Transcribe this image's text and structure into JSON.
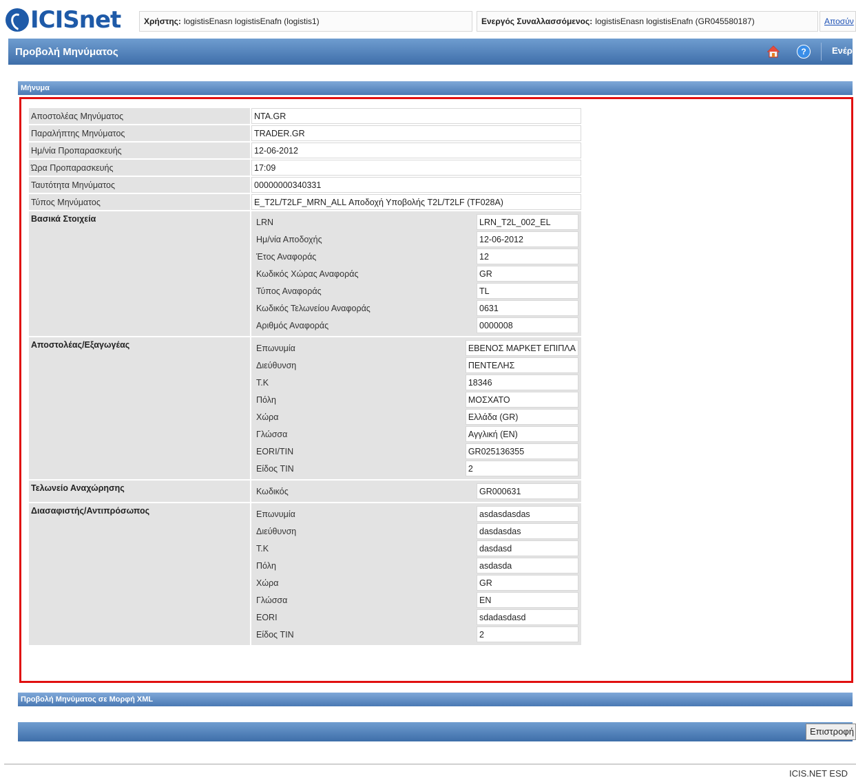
{
  "app": {
    "logo_text": "ICISnet"
  },
  "header": {
    "user_label": "Χρήστης:",
    "user_value": "logistisEnasn logistisEnafn (logistis1)",
    "active_label": "Ενεργός Συναλλασσόμενος:",
    "active_value": "logistisEnasn logistisEnafn (GR045580187)",
    "logout": "Αποσύν"
  },
  "titlebar": {
    "title": "Προβολή Μηνύματος",
    "link": "Ενέργε"
  },
  "section": {
    "title": "Μήνυμα"
  },
  "message": {
    "fields": [
      {
        "label": "Αποστολέας Μηνύματος",
        "value": "NTA.GR"
      },
      {
        "label": "Παραλήπτης Μηνύματος",
        "value": "TRADER.GR"
      },
      {
        "label": "Ημ/νία Προπαρασκευής",
        "value": "12-06-2012"
      },
      {
        "label": "Ώρα Προπαρασκευής",
        "value": "17:09"
      },
      {
        "label": "Ταυτότητα Μηνύματος",
        "value": "00000000340331"
      },
      {
        "label": "Τύπος Μηνύματος",
        "value": "E_T2L/T2LF_MRN_ALL Αποδοχή Υποβολής T2L/T2LF (TF028A)"
      }
    ],
    "groups": [
      {
        "title": "Βασικά Στοιχεία",
        "rows": [
          {
            "label": "LRN",
            "value": "LRN_T2L_002_EL"
          },
          {
            "label": "Ημ/νία Αποδοχής",
            "value": "12-06-2012"
          },
          {
            "label": "Έτος Αναφοράς",
            "value": "12"
          },
          {
            "label": "Κωδικός Χώρας Αναφοράς",
            "value": "GR"
          },
          {
            "label": "Τύπος Αναφοράς",
            "value": "TL"
          },
          {
            "label": "Κωδικός Τελωνείου Αναφοράς",
            "value": "0631"
          },
          {
            "label": "Αριθμός Αναφοράς",
            "value": "0000008"
          }
        ]
      },
      {
        "title": "Αποστολέας/Εξαγωγέας",
        "rows": [
          {
            "label": "Επωνυμία",
            "value": "ΕΒΕΝΟΣ ΜΑΡΚΕΤ ΕΠΙΠΛΑ"
          },
          {
            "label": "Διεύθυνση",
            "value": "ΠΕΝΤΕΛΗΣ"
          },
          {
            "label": "Τ.Κ",
            "value": "18346"
          },
          {
            "label": "Πόλη",
            "value": "ΜΟΣΧΑΤΟ"
          },
          {
            "label": "Χώρα",
            "value": "Ελλάδα (GR)"
          },
          {
            "label": "Γλώσσα",
            "value": "Αγγλική (EN)"
          },
          {
            "label": "EORI/TIN",
            "value": "GR025136355"
          },
          {
            "label": "Είδος TIN",
            "value": "2"
          }
        ]
      },
      {
        "title": "Τελωνείο Αναχώρησης",
        "rows": [
          {
            "label": "Κωδικός",
            "value": "GR000631"
          }
        ]
      },
      {
        "title": "Διασαφιστής/Αντιπρόσωπος",
        "rows": [
          {
            "label": "Επωνυμία",
            "value": "asdasdasdas"
          },
          {
            "label": "Διεύθυνση",
            "value": "dasdasdas"
          },
          {
            "label": "Τ.Κ",
            "value": "dasdasd"
          },
          {
            "label": "Πόλη",
            "value": "asdasda"
          },
          {
            "label": "Χώρα",
            "value": "GR"
          },
          {
            "label": "Γλώσσα",
            "value": "EN"
          },
          {
            "label": "EORI",
            "value": "sdadasdasd"
          },
          {
            "label": "Είδος TIN",
            "value": "2"
          }
        ]
      }
    ]
  },
  "xml_section": {
    "title": "Προβολή Μηνύματος σε Μορφή XML"
  },
  "actions": {
    "return_label": "Επιστροφή"
  },
  "footer": {
    "text": "ICIS.NET ESD"
  },
  "colors": {
    "accent": "#3e6ea9",
    "highlight": "#e01010",
    "label_bg": "#e3e3e3"
  },
  "icons": {
    "home": "home-icon",
    "help": "help-icon"
  }
}
